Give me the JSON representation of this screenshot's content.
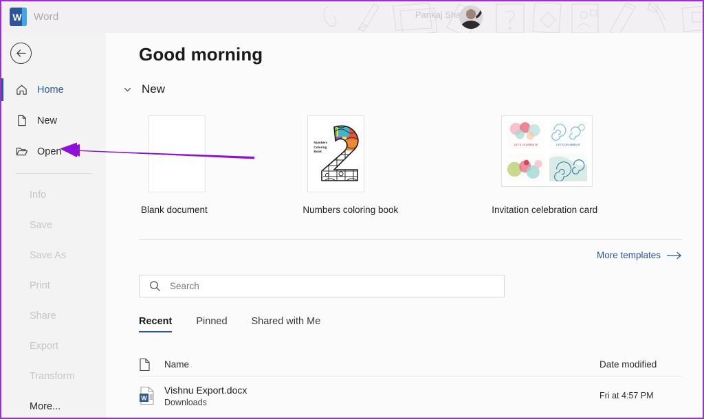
{
  "header": {
    "app_title": "Word",
    "logo_letter": "W",
    "username": "Pankaj Shah",
    "avatar_name": "user-avatar"
  },
  "sidebar": {
    "back_label": "back-arrow-icon",
    "items": [
      {
        "label": "Home",
        "icon": "home-icon",
        "state": "active"
      },
      {
        "label": "New",
        "icon": "new-doc-icon",
        "state": "enabled"
      },
      {
        "label": "Open",
        "icon": "folder-open-icon",
        "state": "enabled"
      },
      {
        "label": "Info",
        "icon": "",
        "state": "disabled"
      },
      {
        "label": "Save",
        "icon": "",
        "state": "disabled"
      },
      {
        "label": "Save As",
        "icon": "",
        "state": "disabled"
      },
      {
        "label": "Print",
        "icon": "",
        "state": "disabled"
      },
      {
        "label": "Share",
        "icon": "",
        "state": "disabled"
      },
      {
        "label": "Export",
        "icon": "",
        "state": "disabled"
      },
      {
        "label": "Transform",
        "icon": "",
        "state": "disabled"
      },
      {
        "label": "More...",
        "icon": "",
        "state": "enabled"
      }
    ]
  },
  "main": {
    "greeting": "Good morning",
    "new_section_title": "New",
    "templates": [
      {
        "label": "Blank document"
      },
      {
        "label": "Numbers coloring book",
        "thumb_text": "Numbers\nColoring\nBook",
        "thumb_digit": "2"
      },
      {
        "label": "Invitation celebration card",
        "caption": "LET'S CELEBRATE"
      }
    ],
    "more_templates_label": "More templates",
    "search": {
      "placeholder": "Search",
      "value": "",
      "icon": "search-icon"
    },
    "tabs": [
      {
        "label": "Recent",
        "active": true
      },
      {
        "label": "Pinned",
        "active": false
      },
      {
        "label": "Shared with Me",
        "active": false
      }
    ],
    "list_headers": {
      "name": "Name",
      "date_modified": "Date modified"
    },
    "documents": [
      {
        "name": "Vishnu Export.docx",
        "location": "Downloads",
        "date_modified": "Fri at 4:57 PM",
        "icon": "word-doc-icon"
      }
    ]
  },
  "annotation": {
    "arrow_color": "#8f10d8",
    "points_to": "Open"
  },
  "colors": {
    "accent_blue": "#2b579a",
    "window_border": "#9b2fd0",
    "main_bg": "#fbfbfb",
    "sidebar_bg": "#f3f3f3"
  }
}
